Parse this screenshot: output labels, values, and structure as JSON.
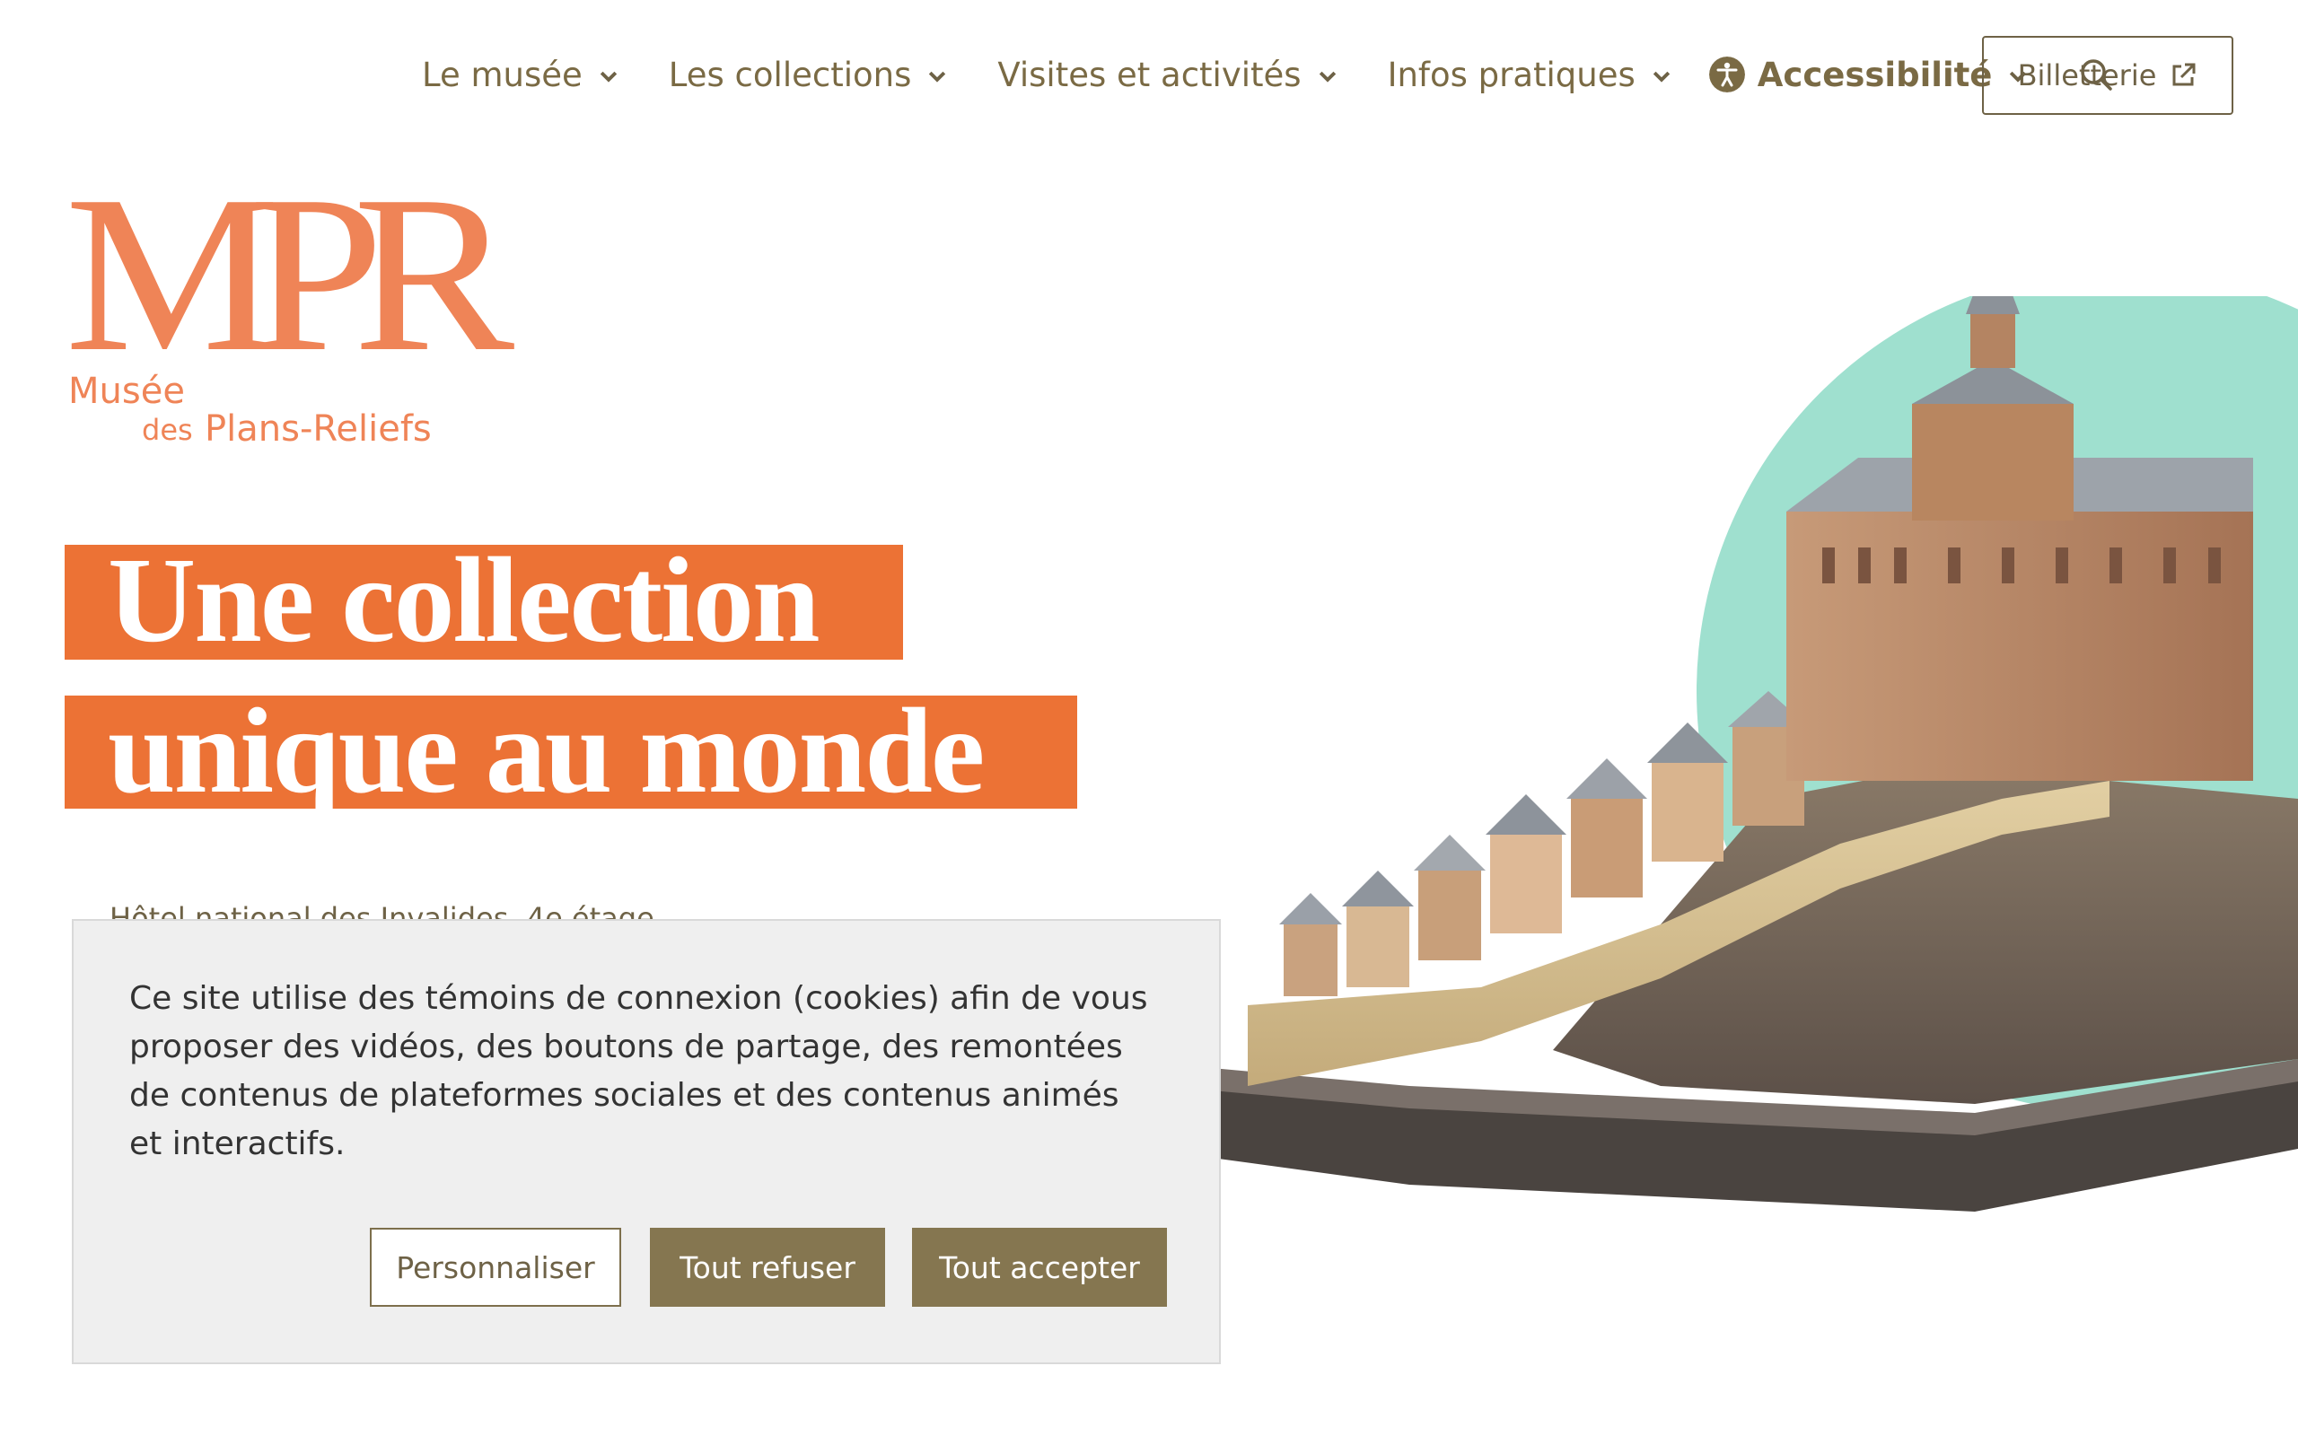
{
  "nav": {
    "items": [
      {
        "label": "Le musée"
      },
      {
        "label": "Les collections"
      },
      {
        "label": "Visites et activités"
      },
      {
        "label": "Infos pratiques"
      },
      {
        "label": "Accessibilité"
      }
    ],
    "ticket_label": "Billetterie"
  },
  "logo": {
    "mark": "MPR",
    "line1": "Musée",
    "des": "des",
    "line2": "Plans-Reliefs"
  },
  "hero": {
    "line1": "Une collection",
    "line2": "unique au monde",
    "subtitle": "Hôtel national des Invalides, 4e étage"
  },
  "cookie": {
    "text": "Ce site utilise des témoins de connexion (cookies) afin de vous proposer des vidéos, des boutons de partage, des remontées de contenus de plateformes sociales et des contenus animés et interactifs.",
    "personalize_label": "Personnaliser",
    "refuse_label": "Tout refuser",
    "accept_label": "Tout accepter"
  },
  "colors": {
    "brand_orange": "#ec7235",
    "logo_orange": "#ef8457",
    "nav_brown": "#7a6a44",
    "button_brown": "#857650",
    "circle_mint": "#9fe0cf"
  }
}
